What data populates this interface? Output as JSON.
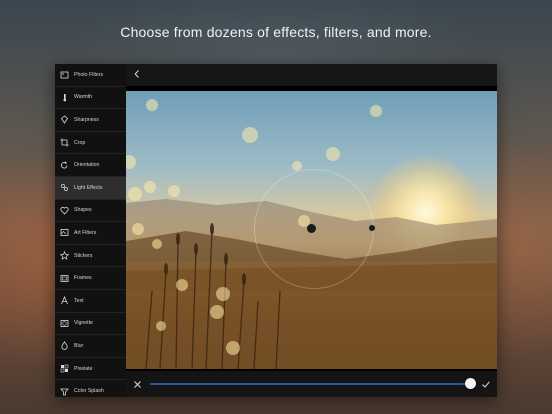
{
  "headline": "Choose from dozens of effects, filters, and more.",
  "sidebar": {
    "items": [
      {
        "label": "Photo Filters",
        "icon": "photo-filters-icon"
      },
      {
        "label": "Warmth",
        "icon": "thermometer-icon"
      },
      {
        "label": "Sharpness",
        "icon": "diamond-icon"
      },
      {
        "label": "Crop",
        "icon": "crop-icon"
      },
      {
        "label": "Orientation",
        "icon": "rotate-icon"
      },
      {
        "label": "Light Effects",
        "icon": "light-effects-icon",
        "active": true
      },
      {
        "label": "Shapes",
        "icon": "heart-icon"
      },
      {
        "label": "Art Filters",
        "icon": "art-filters-icon"
      },
      {
        "label": "Stickers",
        "icon": "star-icon"
      },
      {
        "label": "Frames",
        "icon": "frame-icon"
      },
      {
        "label": "Text",
        "icon": "text-icon"
      },
      {
        "label": "Vignette",
        "icon": "vignette-icon"
      },
      {
        "label": "Blur",
        "icon": "drop-icon"
      },
      {
        "label": "Pixelate",
        "icon": "pixelate-icon"
      },
      {
        "label": "Color Splash",
        "icon": "color-splash-icon"
      }
    ]
  },
  "toolbar": {
    "back_icon": "chevron-left-icon"
  },
  "bottom": {
    "close_icon": "close-icon",
    "confirm_icon": "checkmark-icon",
    "slider_value": 1.0
  },
  "colors": {
    "accent": "#2a5a9a",
    "sidebar_bg": "#111111",
    "active_bg": "#2e2e2e"
  }
}
